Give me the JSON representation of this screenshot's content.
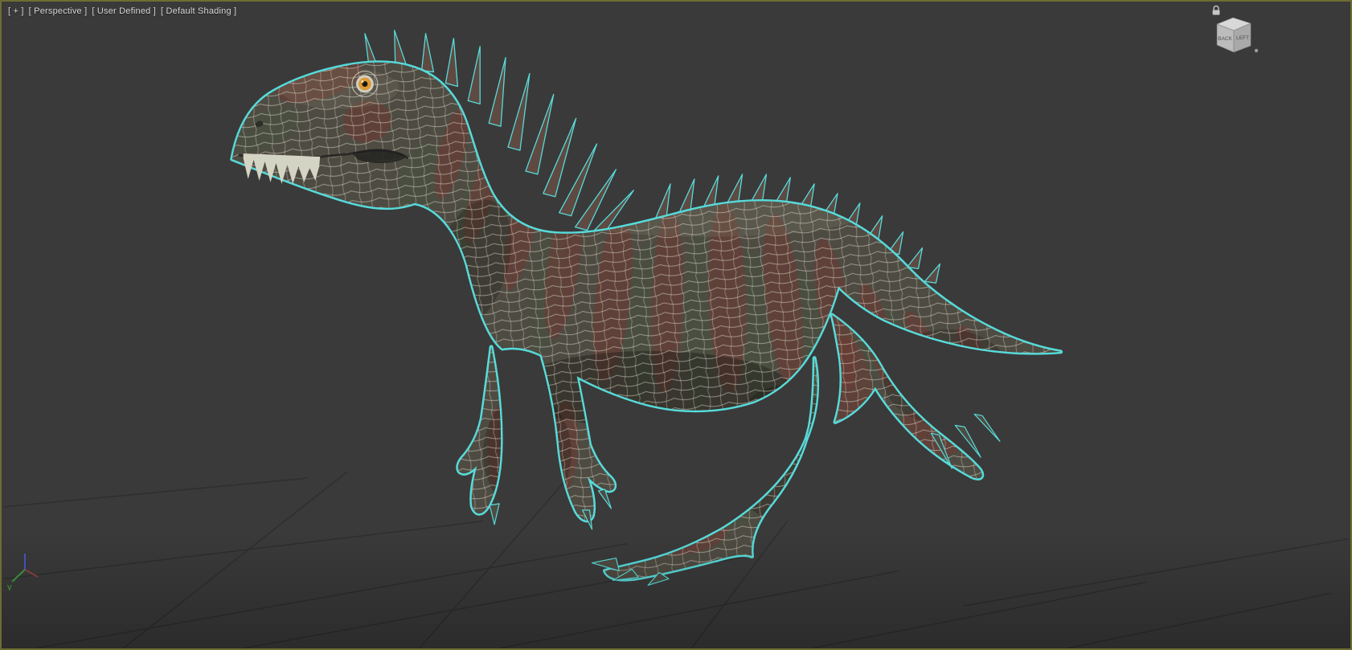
{
  "viewport": {
    "menus": [
      {
        "id": "general",
        "label": "[ + ]"
      },
      {
        "id": "point_of_view",
        "label": "[ Perspective ]"
      },
      {
        "id": "view_name",
        "label": "[ User Defined ]"
      },
      {
        "id": "shading",
        "label": "[ Default Shading ]"
      }
    ]
  },
  "viewcube": {
    "visible_faces": [
      "BACK",
      "LEFT"
    ]
  },
  "axis_gizmo": {
    "y_label": "y"
  },
  "colors": {
    "viewport_background": "#3a3a3a",
    "active_viewport_border": "#6d6d32",
    "selection_outline": "#57dbdb",
    "grid_line": "#2e2e2e"
  }
}
